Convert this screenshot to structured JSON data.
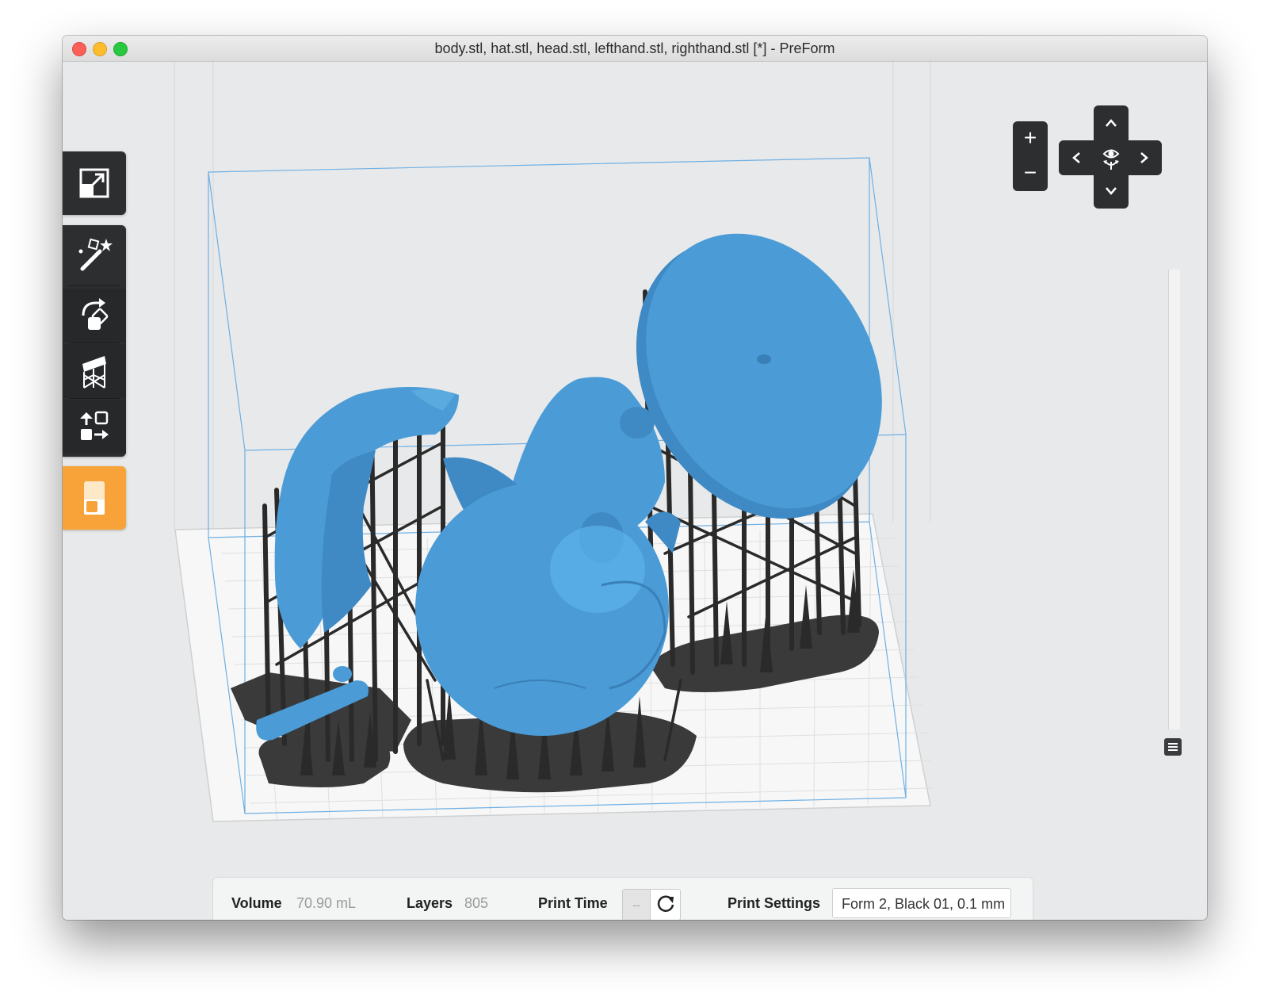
{
  "window": {
    "title": "body.stl, hat.stl, head.stl, lefthand.stl, righthand.stl [*] - PreForm"
  },
  "toolbar": {
    "tools": [
      {
        "id": "scale-to-fit",
        "icon": "expand-icon"
      },
      {
        "id": "auto-orient",
        "icon": "magic-wand-icon"
      },
      {
        "id": "orientation",
        "icon": "rotate-icon"
      },
      {
        "id": "supports",
        "icon": "supports-icon"
      },
      {
        "id": "layout",
        "icon": "layout-icon"
      },
      {
        "id": "print",
        "icon": "print-icon"
      }
    ],
    "accent_color": "#f7a33a"
  },
  "navigation": {
    "zoom_in": "+",
    "zoom_out": "−",
    "pan_up": "up-arrow-icon",
    "pan_down": "down-arrow-icon",
    "pan_left": "left-arrow-icon",
    "pan_right": "right-arrow-icon",
    "view_center": "eye-icon"
  },
  "model_color": "#4a9bd6",
  "support_color": "#2b2b2b",
  "status_bar": {
    "volume_label": "Volume",
    "volume_value": "70.90 mL",
    "layers_label": "Layers",
    "layers_value": "805",
    "print_time_label": "Print Time",
    "print_time_value": "--",
    "print_settings_label": "Print Settings",
    "print_settings_value": "Form 2, Black 01, 0.1 mm"
  }
}
